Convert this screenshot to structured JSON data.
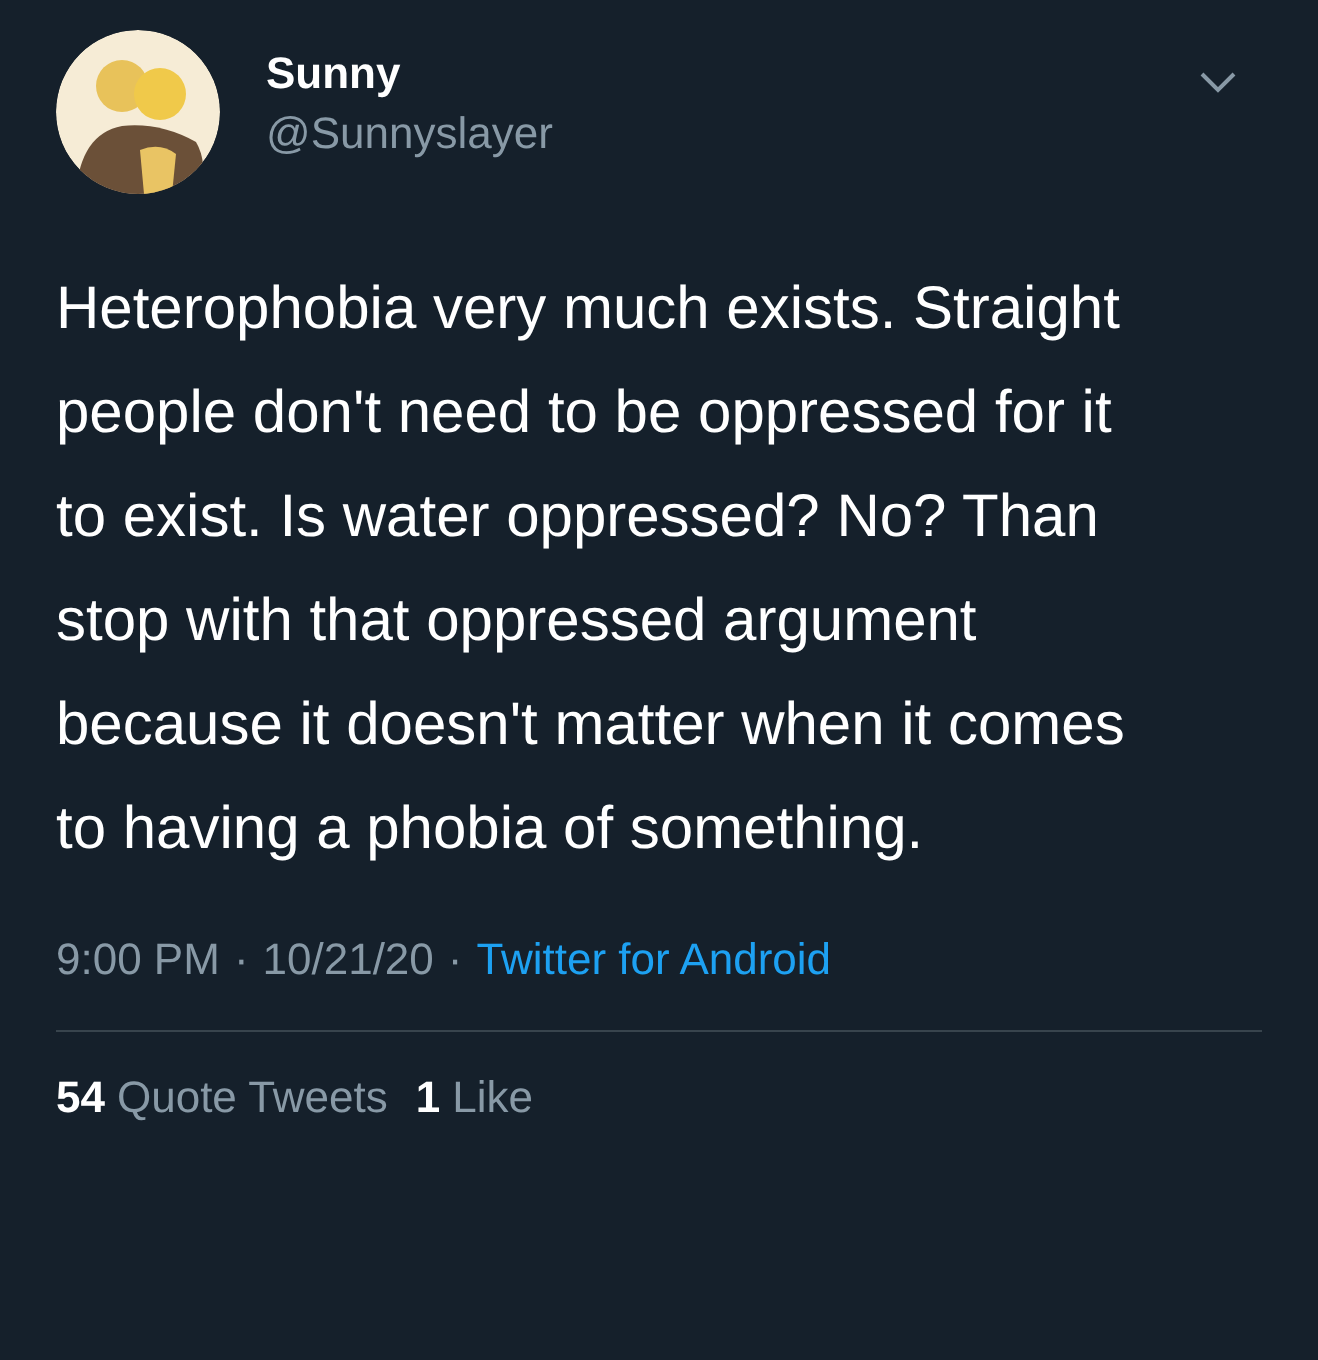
{
  "author": {
    "name": "Sunny",
    "handle": "@Sunnyslayer"
  },
  "text": "Heterophobia very much exists. Straight people don't need to be oppressed for it to exist.  Is water oppressed? No? Than stop with that oppressed argument because it doesn't matter when it comes to having a phobia of something.",
  "meta": {
    "time": "9:00 PM",
    "date": "10/21/20",
    "source": "Twitter for Android",
    "separator": "·"
  },
  "stats": [
    {
      "count": "54",
      "label": "Quote Tweets"
    },
    {
      "count": "1",
      "label": "Like"
    }
  ]
}
